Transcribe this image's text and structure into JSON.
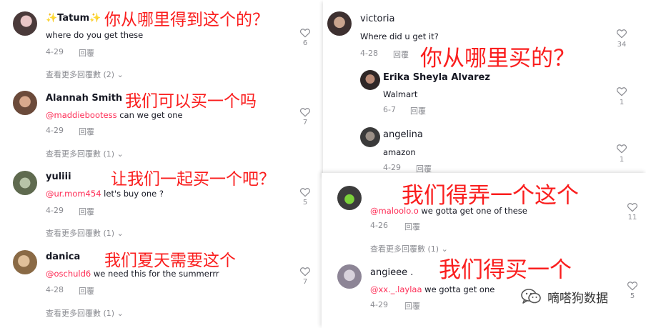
{
  "colors": {
    "mention": "#fe2c55",
    "caption": "#fa1e1e",
    "meta": "#8a8b91"
  },
  "icons": {
    "like": "heart-icon",
    "expand": "chevron-down-icon",
    "watermark": "wechat-icon"
  },
  "comments": {
    "tatum": {
      "user": "✨Tatum✨",
      "text": "where do you get these",
      "date": "4-29",
      "reply": "回覆",
      "likes": "6",
      "view_more": "查看更多回覆數 (2)",
      "caption": "你从哪里得到这个的？"
    },
    "alannah": {
      "user": "Alannah Smith",
      "mention": "@maddiebootess",
      "text": " can we get one",
      "date": "4-29",
      "reply": "回覆",
      "likes": "7",
      "view_more": "查看更多回覆數 (1)",
      "caption": "我们可以买一个吗"
    },
    "yuliii": {
      "user": "yuliii",
      "mention": "@ur.mom454",
      "text": " let's buy one ?",
      "date": "4-29",
      "reply": "回覆",
      "likes": "5",
      "view_more": "查看更多回覆數 (1)",
      "caption": "让我们一起买一个吧？"
    },
    "danica": {
      "user": "danica",
      "mention": "@oschuld6",
      "text": " we need this for the summerrr",
      "date": "4-28",
      "reply": "回覆",
      "likes": "7",
      "view_more": "查看更多回覆數 (1)",
      "caption": "我们夏天需要这个"
    },
    "victoria": {
      "user": "victoria ",
      "text": "Where did u get it?",
      "date": "4-28",
      "reply": "回覆",
      "likes": "34",
      "caption": "你从哪里买的？"
    },
    "erika": {
      "user": "Erika Sheyla Alvarez",
      "text": "Walmart",
      "date": "6-7",
      "reply": "回覆",
      "likes": "1"
    },
    "angelina": {
      "user": "angelina",
      "text": "amazon",
      "date": "4-29",
      "reply": "回覆",
      "likes": "1"
    },
    "maloolo": {
      "user": "",
      "mention": "@maloolo.o",
      "text": " we gotta get one of these",
      "date": "4-26",
      "reply": "回覆",
      "likes": "11",
      "view_more": "查看更多回覆數 (1)",
      "caption": "我们得弄一个这个"
    },
    "angieee": {
      "user": "angieee .",
      "mention": "@xx._.laylaa",
      "text": " we gotta get one",
      "date": "4-29",
      "reply": "回覆",
      "likes": "5",
      "caption": "我们得买一个"
    }
  },
  "watermark": {
    "text": "嘀嗒狗数据"
  }
}
